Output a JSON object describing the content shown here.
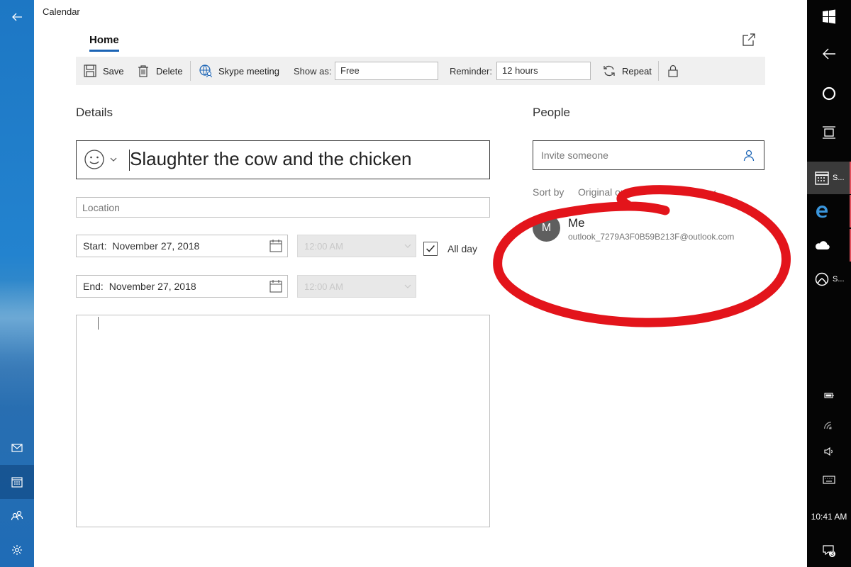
{
  "window": {
    "title": "Calendar"
  },
  "tabs": [
    {
      "label": "Home"
    }
  ],
  "toolbar": {
    "save_label": "Save",
    "delete_label": "Delete",
    "skype_label": "Skype meeting",
    "show_as_label": "Show as:",
    "show_as_value": "Free",
    "reminder_label": "Reminder:",
    "reminder_value": "12 hours",
    "repeat_label": "Repeat"
  },
  "details": {
    "heading": "Details",
    "event_title": "Slaughter the cow and the chicken",
    "location_placeholder": "Location",
    "start": {
      "label": "Start:",
      "date": "November 27, 2018",
      "time": "12:00 AM"
    },
    "end": {
      "label": "End:",
      "date": "November 27, 2018",
      "time": "12:00 AM"
    },
    "all_day_label": "All day",
    "all_day_checked": true
  },
  "people": {
    "heading": "People",
    "invite_placeholder": "Invite someone",
    "sort_label": "Sort by",
    "sort_value": "Original order",
    "attendees": [
      {
        "initial": "M",
        "name": "Me",
        "email": "outlook_7279A3F0B59B213F@outlook.com"
      }
    ]
  },
  "taskbar": {
    "apps": [
      {
        "icon": "calendar-icon",
        "label": "S..."
      },
      {
        "icon": "edge-icon",
        "label": ""
      },
      {
        "icon": "onedrive-icon",
        "label": ""
      },
      {
        "icon": "xbox-icon",
        "label": "S..."
      }
    ],
    "clock": "10:41 AM",
    "notification_count": "3"
  },
  "colors": {
    "accent": "#1b64b5",
    "annotation": "#e3141b",
    "rail": "#1d77c4"
  }
}
